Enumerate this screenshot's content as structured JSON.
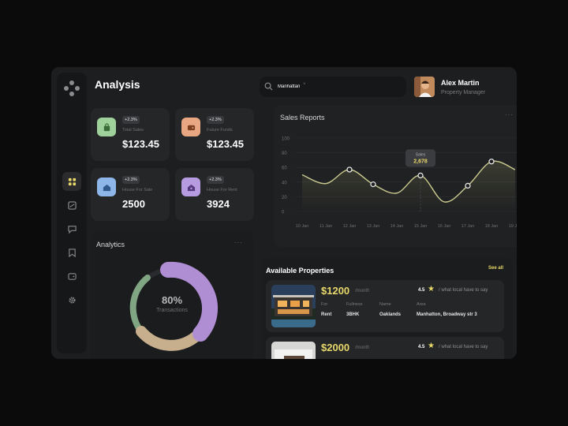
{
  "header": {
    "title": "Analysis"
  },
  "search": {
    "value": "Manhattan",
    "clear": "×"
  },
  "user": {
    "name": "Alex Martin",
    "role": "Property Manager"
  },
  "stats": [
    {
      "badge": "+2.3%",
      "label": "Total Sales",
      "value": "$123.45",
      "icon": "bag-icon",
      "color": "#9fd19b"
    },
    {
      "badge": "+2.3%",
      "label": "Future Funds",
      "value": "$123.45",
      "icon": "wallet-icon",
      "color": "#e8a782"
    },
    {
      "badge": "+2.3%",
      "label": "House For Sale",
      "value": "2500",
      "icon": "house-icon",
      "color": "#8fb6e8"
    },
    {
      "badge": "+2.3%",
      "label": "House For Rent",
      "value": "3924",
      "icon": "key-house-icon",
      "color": "#b79be0"
    }
  ],
  "analytics": {
    "title": "Analytics",
    "menu": "···",
    "percent_label": "80%",
    "caption": "Transactions",
    "segments": [
      {
        "name": "purple",
        "value": 50,
        "color": "#b28fd6"
      },
      {
        "name": "tan",
        "value": 20,
        "color": "#c9b18f"
      },
      {
        "name": "green",
        "value": 18,
        "color": "#8fb88b"
      }
    ]
  },
  "sales": {
    "title": "Sales Reports",
    "menu": "···",
    "tooltip": {
      "label": "Sales",
      "value": "2,678"
    }
  },
  "chart_data": {
    "type": "line",
    "title": "Sales Reports",
    "xlabel": "",
    "ylabel": "",
    "x": [
      "10 Jan",
      "11 Jan",
      "12 Jan",
      "13 Jan",
      "14 Jan",
      "15 Jan",
      "16 Jan",
      "17 Jan",
      "18 Jan",
      "19 Jan"
    ],
    "series": [
      {
        "values": [
          50,
          38,
          57,
          37,
          25,
          49,
          13,
          35,
          68,
          57
        ]
      }
    ],
    "yticks": [
      100,
      80,
      60,
      40,
      20,
      0
    ],
    "ylim": [
      0,
      100
    ],
    "markers": [
      2,
      3,
      5,
      7,
      8
    ],
    "highlight_index": 5,
    "grid": true
  },
  "properties": {
    "title": "Available Properties",
    "see_all": "See all",
    "items": [
      {
        "price": "$1200",
        "period": "/month",
        "rating": "4.5",
        "quote": "/ what local have to say",
        "fields": [
          {
            "key": "For",
            "value": "Rent"
          },
          {
            "key": "Fullness",
            "value": "3BHK"
          },
          {
            "key": "Name",
            "value": "Oaklands"
          },
          {
            "key": "Area",
            "value": "Manhatton, Broadway str 3"
          }
        ]
      },
      {
        "price": "$2000",
        "period": "/month",
        "rating": "4.5",
        "quote": "/ what local have to say"
      }
    ]
  }
}
